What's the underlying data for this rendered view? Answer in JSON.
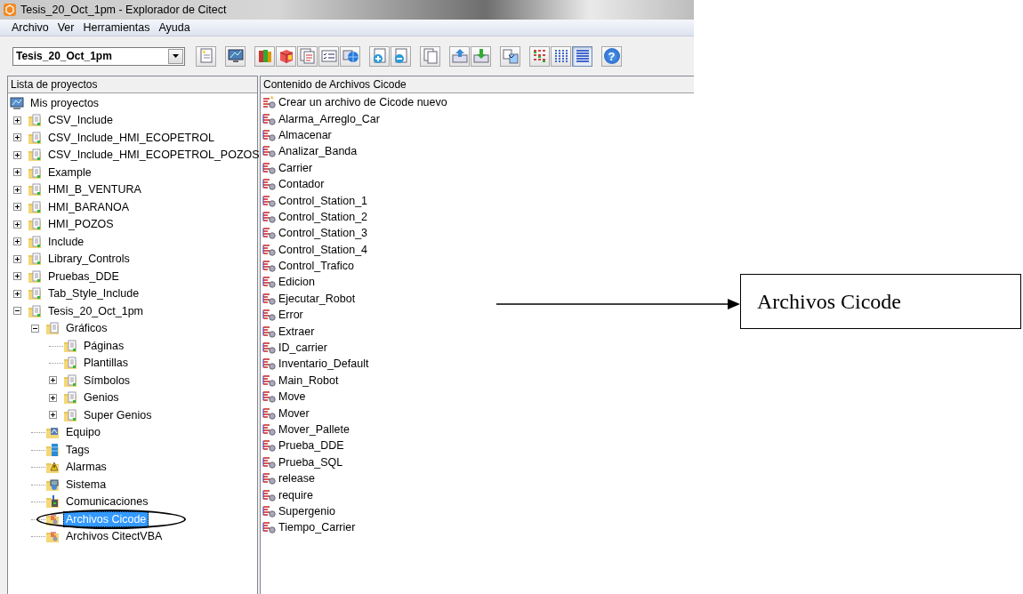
{
  "window": {
    "title": "Tesis_20_Oct_1pm - Explorador de Citect"
  },
  "menu": [
    "Archivo",
    "Ver",
    "Herramientas",
    "Ayuda"
  ],
  "project_combo": {
    "value": "Tesis_20_Oct_1pm"
  },
  "toolbar": [
    {
      "buttons": [
        {
          "kind": "new-project",
          "pressed": false
        }
      ]
    },
    {
      "buttons": [
        {
          "kind": "monitor",
          "pressed": false
        }
      ]
    },
    {
      "buttons": [
        {
          "kind": "books",
          "pressed": false
        },
        {
          "kind": "cube",
          "pressed": false
        },
        {
          "kind": "pages",
          "pressed": false
        },
        {
          "kind": "checklist",
          "pressed": false
        },
        {
          "kind": "globe",
          "pressed": false
        }
      ]
    },
    {
      "buttons": [
        {
          "kind": "page-plus",
          "pressed": false
        },
        {
          "kind": "page-minus",
          "pressed": false
        }
      ]
    },
    {
      "buttons": [
        {
          "kind": "copy",
          "pressed": false
        }
      ]
    },
    {
      "buttons": [
        {
          "kind": "upload",
          "pressed": false
        },
        {
          "kind": "download",
          "pressed": false
        }
      ]
    },
    {
      "buttons": [
        {
          "kind": "swap",
          "pressed": false
        }
      ]
    },
    {
      "buttons": [
        {
          "kind": "grid",
          "pressed": false
        },
        {
          "kind": "columns",
          "pressed": false
        },
        {
          "kind": "list",
          "pressed": true
        }
      ]
    },
    {
      "buttons": [
        {
          "kind": "help",
          "pressed": false,
          "glyph": "?"
        }
      ]
    }
  ],
  "left_pane": {
    "header": "Lista de proyectos",
    "tree": [
      {
        "label": "Mis proyectos",
        "kind": "computer",
        "selected": false,
        "children": [
          {
            "label": "CSV_Include",
            "kind": "project",
            "expanded": false,
            "selected": false
          },
          {
            "label": "CSV_Include_HMI_ECOPETROL",
            "kind": "project",
            "expanded": false,
            "selected": false
          },
          {
            "label": "CSV_Include_HMI_ECOPETROL_POZOS",
            "kind": "project",
            "expanded": false,
            "selected": false
          },
          {
            "label": "Example",
            "kind": "project",
            "expanded": false,
            "selected": false
          },
          {
            "label": "HMI_B_VENTURA",
            "kind": "project",
            "expanded": false,
            "selected": false
          },
          {
            "label": "HMI_BARANOA",
            "kind": "project",
            "expanded": false,
            "selected": false
          },
          {
            "label": "HMI_POZOS",
            "kind": "project",
            "expanded": false,
            "selected": false
          },
          {
            "label": "Include",
            "kind": "project",
            "expanded": false,
            "selected": false
          },
          {
            "label": "Library_Controls",
            "kind": "project",
            "expanded": false,
            "selected": false
          },
          {
            "label": "Pruebas_DDE",
            "kind": "project",
            "expanded": false,
            "selected": false
          },
          {
            "label": "Tab_Style_Include",
            "kind": "project",
            "expanded": false,
            "selected": false
          },
          {
            "label": "Tesis_20_Oct_1pm",
            "kind": "project",
            "expanded": true,
            "selected": false,
            "children": [
              {
                "label": "Gráficos",
                "kind": "graphics",
                "expanded": true,
                "selected": false,
                "children": [
                  {
                    "label": "Páginas",
                    "kind": "project",
                    "selected": false
                  },
                  {
                    "label": "Plantillas",
                    "kind": "project",
                    "selected": false
                  },
                  {
                    "label": "Símbolos",
                    "kind": "project",
                    "expanded": false,
                    "selected": false
                  },
                  {
                    "label": "Genios",
                    "kind": "project",
                    "expanded": false,
                    "selected": false
                  },
                  {
                    "label": "Super Genios",
                    "kind": "project",
                    "expanded": false,
                    "selected": false
                  }
                ]
              },
              {
                "label": "Equipo",
                "kind": "equipment",
                "selected": false
              },
              {
                "label": "Tags",
                "kind": "tags",
                "selected": false
              },
              {
                "label": "Alarmas",
                "kind": "alarms",
                "selected": false
              },
              {
                "label": "Sistema",
                "kind": "system",
                "selected": false
              },
              {
                "label": "Comunicaciones",
                "kind": "comms",
                "selected": false
              },
              {
                "label": "Archivos Cicode",
                "kind": "code",
                "selected": true
              },
              {
                "label": "Archivos CitectVBA",
                "kind": "code",
                "selected": false
              }
            ]
          }
        ]
      }
    ]
  },
  "right_pane": {
    "header": "Contenido de Archivos Cicode",
    "items": [
      {
        "label": "Crear un archivo de Cicode nuevo",
        "kind": "new"
      },
      {
        "label": "Alarma_Arreglo_Car",
        "kind": "file"
      },
      {
        "label": "Almacenar",
        "kind": "file"
      },
      {
        "label": "Analizar_Banda",
        "kind": "file"
      },
      {
        "label": "Carrier",
        "kind": "file"
      },
      {
        "label": "Contador",
        "kind": "file"
      },
      {
        "label": "Control_Station_1",
        "kind": "file"
      },
      {
        "label": "Control_Station_2",
        "kind": "file"
      },
      {
        "label": "Control_Station_3",
        "kind": "file"
      },
      {
        "label": "Control_Station_4",
        "kind": "file"
      },
      {
        "label": "Control_Trafico",
        "kind": "file"
      },
      {
        "label": "Edicion",
        "kind": "file"
      },
      {
        "label": "Ejecutar_Robot",
        "kind": "file"
      },
      {
        "label": "Error",
        "kind": "file"
      },
      {
        "label": "Extraer",
        "kind": "file"
      },
      {
        "label": "ID_carrier",
        "kind": "file"
      },
      {
        "label": "Inventario_Default",
        "kind": "file"
      },
      {
        "label": "Main_Robot",
        "kind": "file"
      },
      {
        "label": "Move",
        "kind": "file"
      },
      {
        "label": "Mover",
        "kind": "file"
      },
      {
        "label": "Mover_Pallete",
        "kind": "file"
      },
      {
        "label": "Prueba_DDE",
        "kind": "file"
      },
      {
        "label": "Prueba_SQL",
        "kind": "file"
      },
      {
        "label": "release",
        "kind": "file"
      },
      {
        "label": "require",
        "kind": "file"
      },
      {
        "label": "Supergenio",
        "kind": "file"
      },
      {
        "label": "Tiempo_Carrier",
        "kind": "file"
      }
    ]
  },
  "annotation": {
    "callout": "Archivos Cicode"
  }
}
